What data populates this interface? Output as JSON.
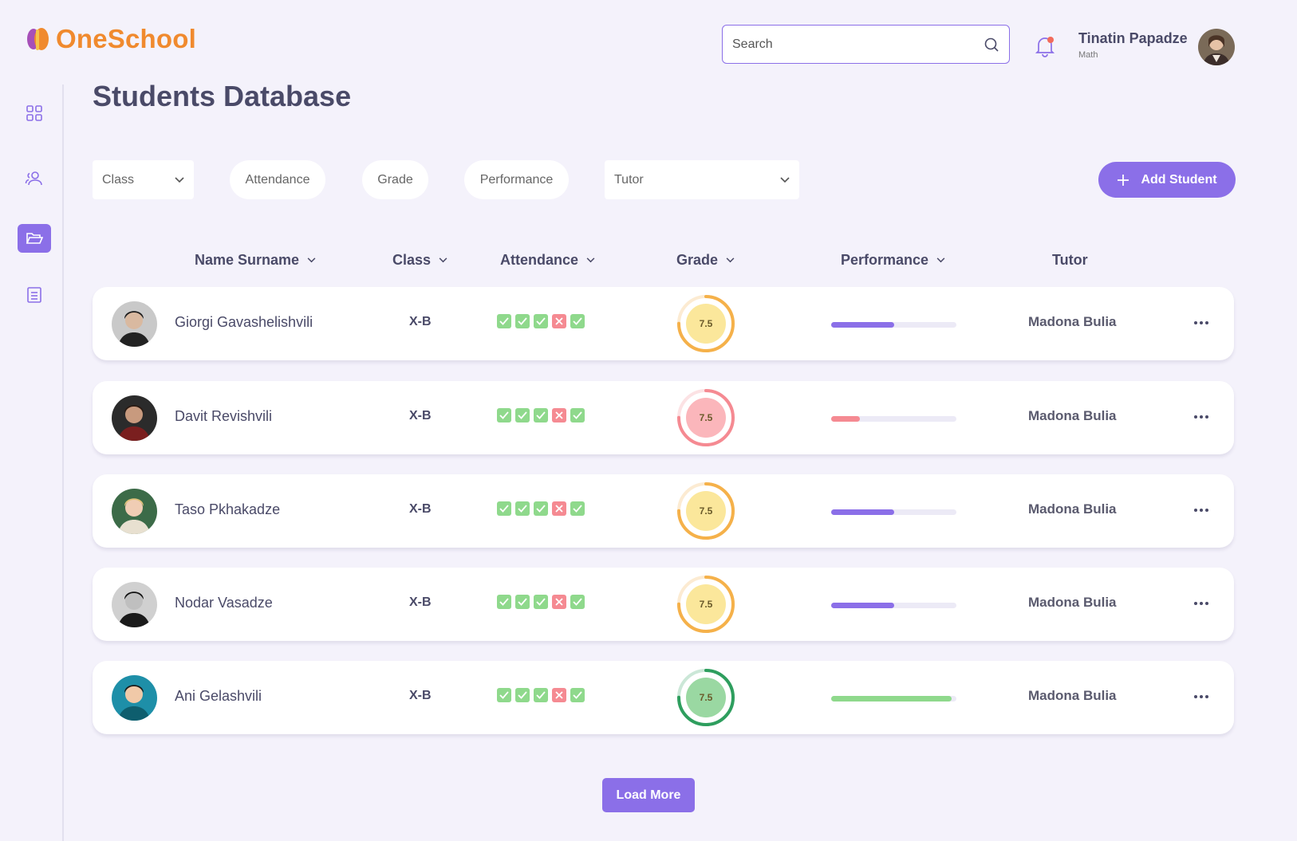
{
  "app": {
    "name": "OneSchool"
  },
  "header": {
    "search_placeholder": "Search",
    "user": {
      "name": "Tinatin Papadze",
      "subject": "Math"
    }
  },
  "sidebar": {
    "items": [
      {
        "icon": "dashboard-grid-icon",
        "active": false
      },
      {
        "icon": "users-icon",
        "active": false
      },
      {
        "icon": "folder-open-icon",
        "active": true
      },
      {
        "icon": "document-icon",
        "active": false
      }
    ]
  },
  "page": {
    "title": "Students Database"
  },
  "filters": {
    "class": "Class",
    "attendance": "Attendance",
    "grade": "Grade",
    "performance": "Performance",
    "tutor": "Tutor"
  },
  "add_button": "Add Student",
  "table": {
    "headers": {
      "name": "Name Surname",
      "class": "Class",
      "attendance": "Attendance",
      "grade": "Grade",
      "performance": "Performance",
      "tutor": "Tutor"
    },
    "rows": [
      {
        "name": "Giorgi Gavashelishvili",
        "class": "X-B",
        "attendance": [
          "present",
          "present",
          "present",
          "absent",
          "present"
        ],
        "grade": "7.5",
        "grade_color": "#f5b14a",
        "grade_bg": "#fbe79b",
        "grade_progress": 0.75,
        "performance": 0.5,
        "perf_color": "#8b6fe8",
        "tutor": "Madona Bulia"
      },
      {
        "name": "Davit Revishvili",
        "class": "X-B",
        "attendance": [
          "present",
          "present",
          "present",
          "absent",
          "present"
        ],
        "grade": "7.5",
        "grade_color": "#f58a92",
        "grade_bg": "#fbb6bb",
        "grade_progress": 0.75,
        "performance": 0.23,
        "perf_color": "#f58a92",
        "tutor": "Madona Bulia"
      },
      {
        "name": "Taso Pkhakadze",
        "class": "X-B",
        "attendance": [
          "present",
          "present",
          "present",
          "absent",
          "present"
        ],
        "grade": "7.5",
        "grade_color": "#f5b14a",
        "grade_bg": "#fbe79b",
        "grade_progress": 0.75,
        "performance": 0.5,
        "perf_color": "#8b6fe8",
        "tutor": "Madona Bulia"
      },
      {
        "name": "Nodar Vasadze",
        "class": "X-B",
        "attendance": [
          "present",
          "present",
          "present",
          "absent",
          "present"
        ],
        "grade": "7.5",
        "grade_color": "#f5b14a",
        "grade_bg": "#fbe79b",
        "grade_progress": 0.75,
        "performance": 0.5,
        "perf_color": "#8b6fe8",
        "tutor": "Madona Bulia"
      },
      {
        "name": "Ani Gelashvili",
        "class": "X-B",
        "attendance": [
          "present",
          "present",
          "present",
          "absent",
          "present"
        ],
        "grade": "7.5",
        "grade_color": "#2e9e5e",
        "grade_bg": "#9ad8a2",
        "grade_progress": 0.75,
        "performance": 0.96,
        "perf_color": "#8fd98c",
        "tutor": "Madona Bulia"
      }
    ]
  },
  "load_more": "Load More",
  "colors": {
    "accent": "#8b6fe8",
    "logo": "#f08a2e",
    "background": "#f4f2fb"
  }
}
